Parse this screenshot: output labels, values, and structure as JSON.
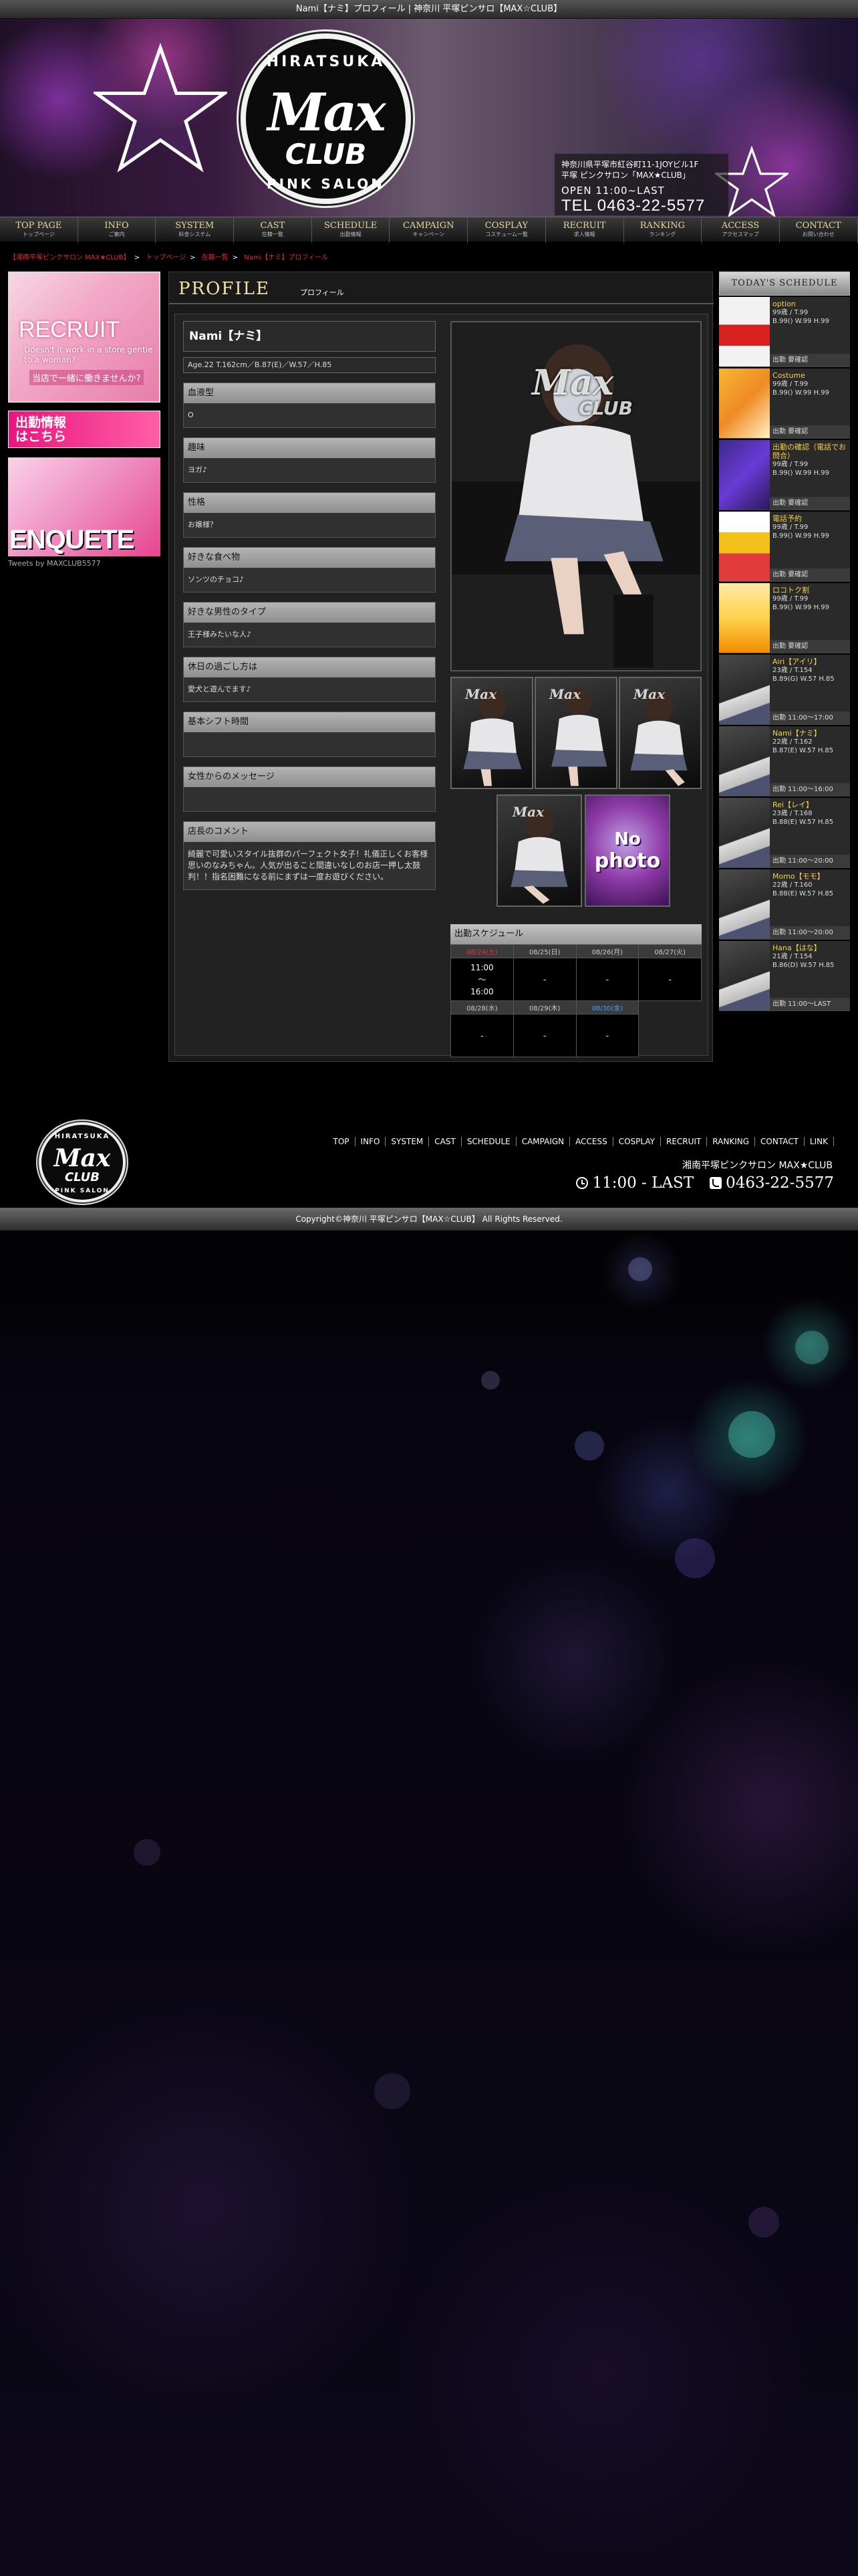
{
  "page_title": "Nami【ナミ】プロフィール | 神奈川 平塚ピンサロ【MAX☆CLUB】",
  "header": {
    "logo_top": "HIRATSUKA",
    "logo_main": "Max",
    "logo_sub": "CLUB",
    "logo_bottom": "PINK SALON",
    "address": "神奈川県平塚市紅谷町11-1JOYビル1F",
    "shop": "平塚 ピンクサロン「MAX★CLUB」",
    "open": "OPEN  11:00~LAST",
    "tel": "TEL 0463-22-5577"
  },
  "nav": [
    {
      "en": "TOP PAGE",
      "ja": "トップページ"
    },
    {
      "en": "INFO",
      "ja": "ご案内"
    },
    {
      "en": "SYSTEM",
      "ja": "料金システム"
    },
    {
      "en": "CAST",
      "ja": "在籍一覧"
    },
    {
      "en": "SCHEDULE",
      "ja": "出勤情報"
    },
    {
      "en": "CAMPAIGN",
      "ja": "キャンペーン"
    },
    {
      "en": "COSPLAY",
      "ja": "コスチューム一覧"
    },
    {
      "en": "RECRUIT",
      "ja": "求人情報"
    },
    {
      "en": "RANKING",
      "ja": "ランキング"
    },
    {
      "en": "ACCESS",
      "ja": "アクセスマップ"
    },
    {
      "en": "CONTACT",
      "ja": "お問い合わせ"
    }
  ],
  "breadcrumb": {
    "home": "【湘南平塚ピンクサロン MAX★CLUB】",
    "top": "トップページ",
    "list": "在籍一覧",
    "current": "Nami【ナミ】プロフィール"
  },
  "left": {
    "recruit_title": "RECRUIT",
    "recruit_sub": "Doesn't it work in a store gentle to a woman?",
    "recruit_ja": "当店で一緒に働きませんか?",
    "attend_title": "出勤情報",
    "attend_sub": "はこちら",
    "enquete": "ENQUETE",
    "tweets": "Tweets by MAXCLUB5577"
  },
  "profile": {
    "section_title": "PROFILE",
    "section_sub": "プロフィール",
    "name": "Nami【ナミ】",
    "spec": "Age.22 T.162cm／B.87(E)／W.57／H.85",
    "fields": [
      {
        "label": "血液型",
        "value": "O"
      },
      {
        "label": "趣味",
        "value": "ヨガ♪"
      },
      {
        "label": "性格",
        "value": "お嬢様？"
      },
      {
        "label": "好きな食べ物",
        "value": "ソンツのチョコ♪"
      },
      {
        "label": "好きな男性のタイプ",
        "value": "王子様みたいな人♪"
      },
      {
        "label": "休日の過ごし方は",
        "value": "愛犬と遊んでます♪"
      },
      {
        "label": "基本シフト時間",
        "value": ""
      },
      {
        "label": "女性からのメッセージ",
        "value": ""
      },
      {
        "label": "店長のコメント",
        "value": "綺麗で可愛いスタイル抜群のパーフェクト女子！礼儀正しくお客様思いのなみちゃん。人気が出ること間違いなしのお店一押し太鼓判！！指名困難になる前にまずは一度お遊びください。"
      }
    ],
    "watermark_main": "Max",
    "watermark_sub": "CLUB",
    "nophoto_1": "No",
    "nophoto_2": "photo"
  },
  "schedule": {
    "title": "出勤スケジュール",
    "days": [
      {
        "date": "08/24(土)",
        "value": "11:00\n～\n16:00",
        "color": "#e33"
      },
      {
        "date": "08/25(日)",
        "value": "-",
        "color": "#ccc"
      },
      {
        "date": "08/26(月)",
        "value": "-",
        "color": "#ccc"
      },
      {
        "date": "08/27(火)",
        "value": "-",
        "color": "#ccc"
      },
      {
        "date": "08/28(水)",
        "value": "-",
        "color": "#ccc"
      },
      {
        "date": "08/29(木)",
        "value": "-",
        "color": "#ccc"
      },
      {
        "date": "08/30(金)",
        "value": "-",
        "color": "#3aa0ff"
      }
    ]
  },
  "today_schedule": {
    "title": "TODAY'S SCHEDULE",
    "entries": [
      {
        "name": "option",
        "age": "99歳 / T.99",
        "body": "B.99() W.99 H.99",
        "time": "出勤 要確認",
        "thumb": "option"
      },
      {
        "name": "Costume",
        "age": "99歳 / T.99",
        "body": "B.99() W.99 H.99",
        "time": "出勤 要確認",
        "thumb": "costume"
      },
      {
        "name": "出勤の確認（電話でお問合）",
        "age": "99歳 / T.99",
        "body": "B.99() W.99 H.99",
        "time": "出勤 要確認",
        "thumb": "confirm"
      },
      {
        "name": "電話予約",
        "age": "99歳 / T.99",
        "body": "B.99() W.99 H.99",
        "time": "出勤 要確認",
        "thumb": "reserve"
      },
      {
        "name": "ロコトク割",
        "age": "99歳 / T.99",
        "body": "B.99() W.99 H.99",
        "time": "出勤 要確認",
        "thumb": "discount"
      },
      {
        "name": "Airi【アイリ】",
        "age": "23歳 / T.154",
        "body": "B.89(G) W.57 H.85",
        "time": "出勤 11:00～17:00",
        "thumb": "girl"
      },
      {
        "name": "Nami【ナミ】",
        "age": "22歳 / T.162",
        "body": "B.87(E) W.57 H.85",
        "time": "出勤 11:00～16:00",
        "thumb": "girl"
      },
      {
        "name": "Rei【レイ】",
        "age": "23歳 / T.168",
        "body": "B.88(E) W.57 H.85",
        "time": "出勤 11:00～20:00",
        "thumb": "girl"
      },
      {
        "name": "Momo【モモ】",
        "age": "22歳 / T.160",
        "body": "B.88(E) W.57 H.85",
        "time": "出勤 11:00～20:00",
        "thumb": "girl"
      },
      {
        "name": "Hana【はな】",
        "age": "21歳 / T.154",
        "body": "B.86(D) W.57 H.85",
        "time": "出勤 11:00～LAST",
        "thumb": "girl"
      }
    ]
  },
  "footer": {
    "logo_top": "HIRATSUKA",
    "logo_main": "Max",
    "logo_sub": "CLUB",
    "logo_bottom": "PINK SALON",
    "links": [
      "TOP",
      "INFO",
      "SYSTEM",
      "CAST",
      "SCHEDULE",
      "CAMPAIGN",
      "ACCESS",
      "COSPLAY",
      "RECRUIT",
      "RANKING",
      "CONTACT",
      "LINK"
    ],
    "shop": "湘南平塚ピンクサロン MAX★CLUB",
    "hours": "11:00 - LAST",
    "tel": "0463-22-5577",
    "copyright": "Copyright©神奈川 平塚ピンサロ【MAX☆CLUB】 All Rights Reserved."
  },
  "colors": {
    "accent_red": "#e02b35",
    "gold": "#f2e2a8",
    "name_yellow": "#f5d04a"
  }
}
